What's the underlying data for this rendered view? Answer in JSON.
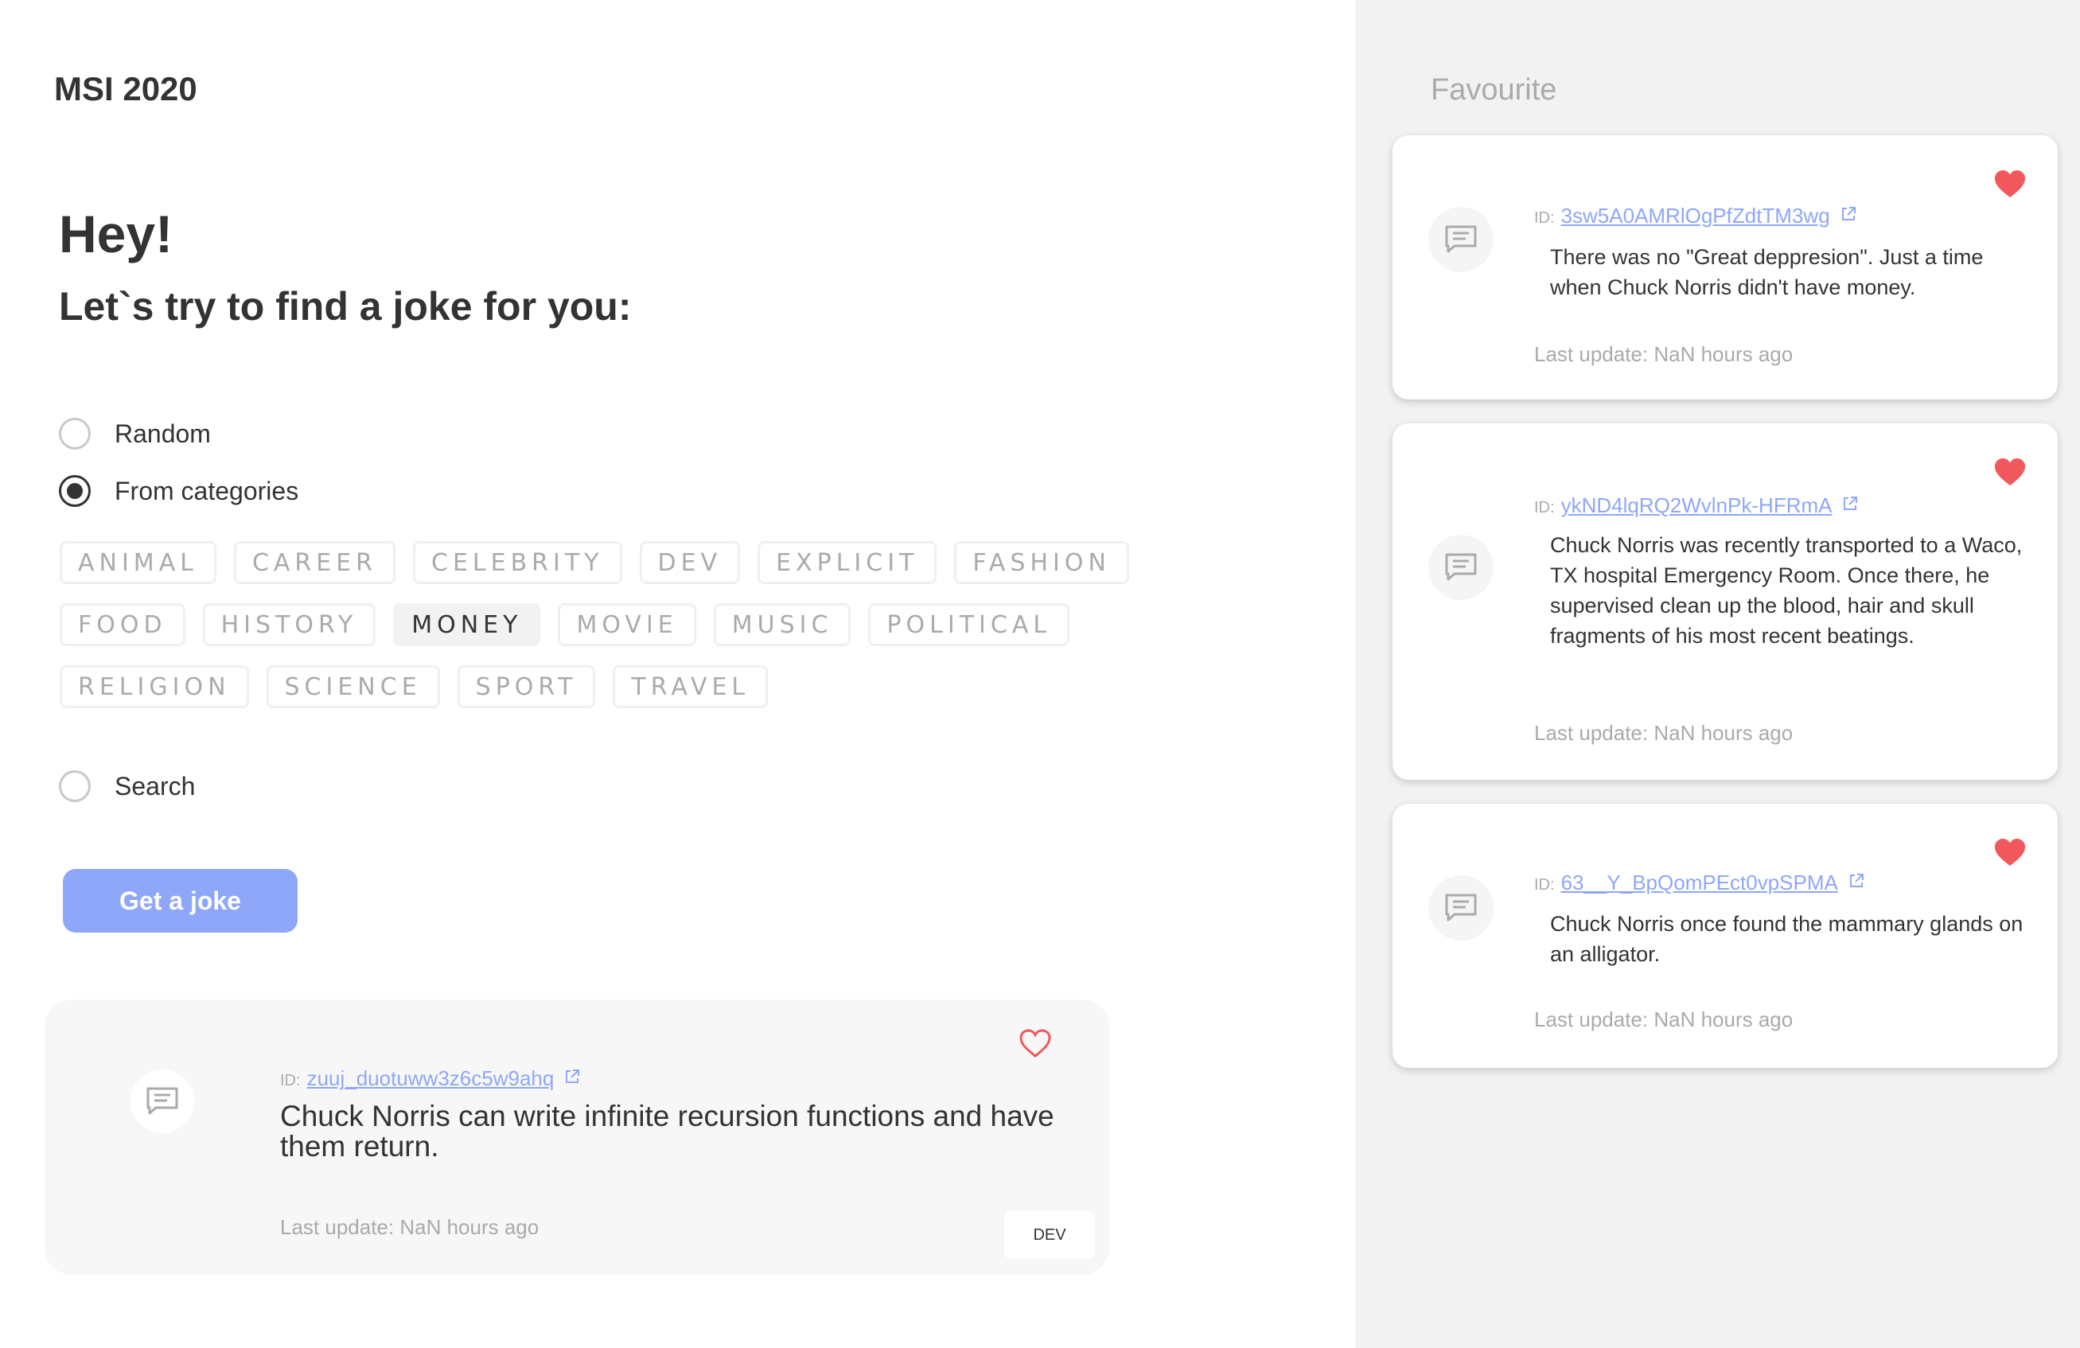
{
  "app": {
    "title": "MSI 2020"
  },
  "header": {
    "greeting": "Hey!",
    "subtitle": "Let`s try to find a joke for you:"
  },
  "options": {
    "random": "Random",
    "categories": "From categories",
    "search": "Search",
    "selected": "categories"
  },
  "categories": {
    "rows": [
      [
        "ANIMAL",
        "CAREER",
        "CELEBRITY",
        "DEV",
        "EXPLICIT",
        "FASHION"
      ],
      [
        "FOOD",
        "HISTORY",
        "MONEY",
        "MOVIE",
        "MUSIC",
        "POLITICAL"
      ],
      [
        "RELIGION",
        "SCIENCE",
        "SPORT",
        "TRAVEL"
      ]
    ],
    "active": "MONEY"
  },
  "button": {
    "label": "Get a joke"
  },
  "joke": {
    "id_label": "ID:",
    "id": "zuuj_duotuww3z6c5w9ahq",
    "text": "Chuck Norris can write infinite recursion functions and have them return.",
    "last_update": "Last update: NaN hours ago",
    "category": "DEV"
  },
  "favourites": {
    "title": "Favourite",
    "items": [
      {
        "id_label": "ID:",
        "id": "3sw5A0AMRlOgPfZdtTM3wg",
        "text": "There was no \"Great deppresion\". Just a time when Chuck Norris didn't have money.",
        "last_update": "Last update: NaN hours ago"
      },
      {
        "id_label": "ID:",
        "id": "ykND4lqRQ2WvlnPk-HFRmA",
        "text": "Chuck Norris was recently transported to a Waco, TX hospital Emergency Room. Once there, he supervised clean up the blood, hair and skull fragments of his most recent beatings.",
        "last_update": "Last update: NaN hours ago"
      },
      {
        "id_label": "ID:",
        "id": "63__Y_BpQomPEct0vpSPMA",
        "text": "Chuck Norris once found the mammary glands on an alligator.",
        "last_update": "Last update: NaN hours ago"
      }
    ]
  },
  "icons": {
    "message": "message-icon",
    "external": "external-link-icon",
    "heart": "heart-icon"
  },
  "colors": {
    "accent": "#8ea7f9",
    "heart": "#f0585d",
    "sidebar_bg": "#f2f2f2"
  }
}
